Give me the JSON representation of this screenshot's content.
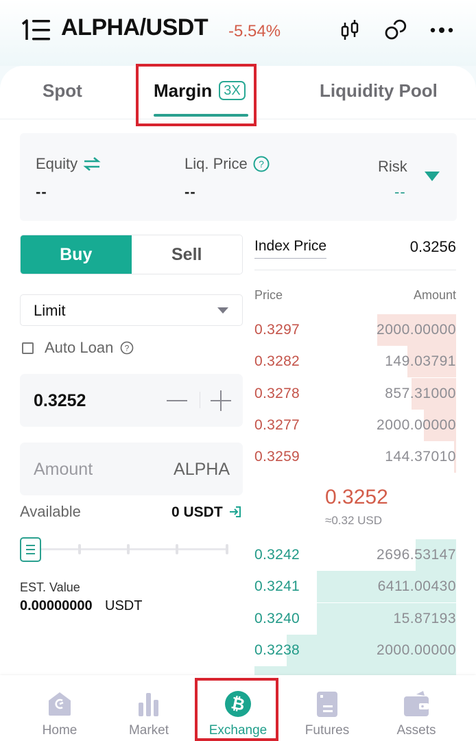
{
  "header": {
    "pair": "ALPHA/USDT",
    "change": "-5.54%",
    "icons": [
      "menu-icon",
      "candlestick-chart-icon",
      "link-icon",
      "more-icon"
    ]
  },
  "tabs": [
    {
      "label": "Spot",
      "active": false
    },
    {
      "label": "Margin",
      "badge": "3X",
      "active": true
    },
    {
      "label": "Liquidity Pool",
      "active": false
    }
  ],
  "info": {
    "equity_label": "Equity",
    "equity_value": "--",
    "liq_label": "Liq. Price",
    "liq_value": "--",
    "risk_label": "Risk",
    "risk_value": "--"
  },
  "order_form": {
    "buy_label": "Buy",
    "sell_label": "Sell",
    "order_type": "Limit",
    "auto_loan_label": "Auto Loan",
    "auto_loan_checked": false,
    "price_value": "0.3252",
    "amount_placeholder": "Amount",
    "amount_unit": "ALPHA",
    "available_label": "Available",
    "available_value": "0 USDT",
    "slider_percent": 0,
    "est_label": "EST. Value",
    "est_value": "0.00000000",
    "est_unit": "USDT"
  },
  "orderbook": {
    "index_label": "Index Price",
    "index_value": "0.3256",
    "price_header": "Price",
    "amount_header": "Amount",
    "asks": [
      {
        "price": "0.3297",
        "amount": "2000.00000",
        "depth": 0.39
      },
      {
        "price": "0.3282",
        "amount": "149.03791",
        "depth": 0.24
      },
      {
        "price": "0.3278",
        "amount": "857.31000",
        "depth": 0.22
      },
      {
        "price": "0.3277",
        "amount": "2000.00000",
        "depth": 0.16
      },
      {
        "price": "0.3259",
        "amount": "144.37010",
        "depth": 0.01
      }
    ],
    "last_price": "0.3252",
    "last_price_usd": "≈0.32 USD",
    "bids": [
      {
        "price": "0.3242",
        "amount": "2696.53147",
        "depth": 0.2
      },
      {
        "price": "0.3241",
        "amount": "6411.00430",
        "depth": 0.69
      },
      {
        "price": "0.3240",
        "amount": "15.87193",
        "depth": 0.69
      },
      {
        "price": "0.3238",
        "amount": "2000.00000",
        "depth": 0.84
      }
    ]
  },
  "nav": [
    {
      "label": "Home",
      "icon": "home-icon",
      "active": false
    },
    {
      "label": "Market",
      "icon": "market-chart-icon",
      "active": false
    },
    {
      "label": "Exchange",
      "icon": "bitcoin-exchange-icon",
      "active": true
    },
    {
      "label": "Futures",
      "icon": "futures-icon",
      "active": false
    },
    {
      "label": "Assets",
      "icon": "wallet-icon",
      "active": false
    }
  ],
  "colors": {
    "accent": "#17ab93",
    "ask": "#c4544a",
    "bid": "#229a88",
    "highlight": "#d8242f"
  }
}
